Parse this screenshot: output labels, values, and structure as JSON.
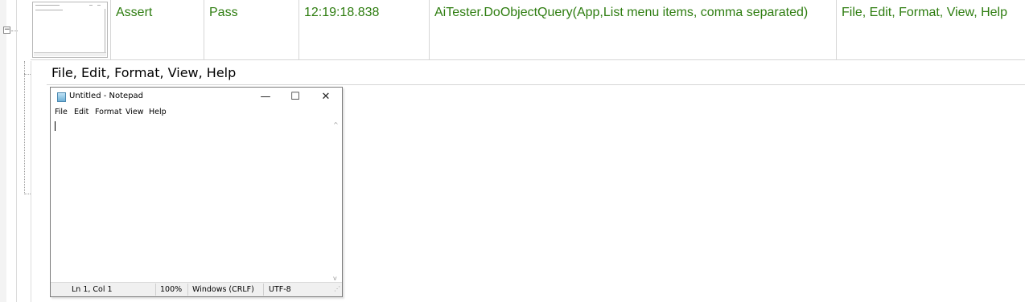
{
  "row": {
    "type": "Assert",
    "result": "Pass",
    "time": "12:19:18.838",
    "command": "AiTester.DoObjectQuery(App,List menu items, comma separated)",
    "output": "File, Edit, Format, View, Help"
  },
  "detail": {
    "text": "File, Edit, Format, View, Help"
  },
  "notepad": {
    "title": "Untitled - Notepad",
    "controls": {
      "minimize": "—",
      "maximize": "☐",
      "close": "✕"
    },
    "menu": [
      "File",
      "Edit",
      "Format",
      "View",
      "Help"
    ],
    "status": {
      "position": "Ln 1, Col 1",
      "zoom": "100%",
      "line_ending": "Windows (CRLF)",
      "encoding": "UTF-8"
    }
  },
  "colors": {
    "pass_text": "#2e7d10"
  },
  "icons": [
    "collapse-icon",
    "notepad-app-icon",
    "minimize-icon",
    "maximize-icon",
    "close-icon"
  ]
}
